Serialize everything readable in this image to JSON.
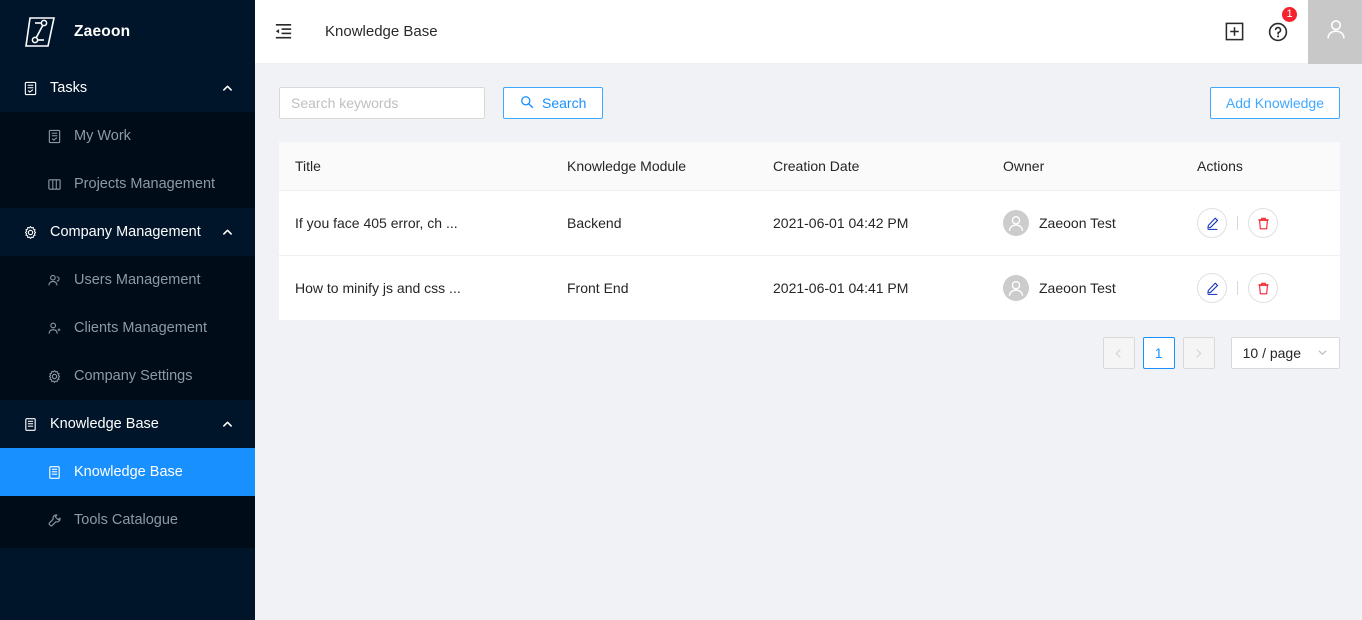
{
  "brand": {
    "name": "Zaeoon",
    "logo_icon": "zaeoon-z-logo",
    "accent": "#1890ff",
    "sidebar_bg": "#001529"
  },
  "sidebar": {
    "groups": [
      {
        "label": "Tasks",
        "icon": "tasks-book-icon",
        "expanded": true,
        "items": [
          {
            "label": "My Work",
            "icon": "book-icon",
            "active": false
          },
          {
            "label": "Projects Management",
            "icon": "project-board-icon",
            "active": false
          }
        ]
      },
      {
        "label": "Company Management",
        "icon": "gear-icon",
        "expanded": true,
        "items": [
          {
            "label": "Users Management",
            "icon": "team-icon",
            "active": false
          },
          {
            "label": "Clients Management",
            "icon": "user-add-icon",
            "active": false
          },
          {
            "label": "Company Settings",
            "icon": "gear-icon",
            "active": false
          }
        ]
      },
      {
        "label": "Knowledge Base",
        "icon": "book-icon",
        "expanded": true,
        "items": [
          {
            "label": "Knowledge Base",
            "icon": "book-icon",
            "active": true
          },
          {
            "label": "Tools Catalogue",
            "icon": "wrench-icon",
            "active": false
          }
        ]
      }
    ],
    "collapse_chevron_icon": "chevron-up-icon"
  },
  "topbar": {
    "fold_icon": "menu-fold-icon",
    "title": "Knowledge Base",
    "add_icon": "plus-square-icon",
    "help_icon": "question-circle-icon",
    "help_badge": "1",
    "badge_color": "#f5222d",
    "avatar_icon": "user-avatar-icon"
  },
  "toolbar": {
    "search_placeholder": "Search keywords",
    "search_value": "",
    "search_icon": "search-icon",
    "search_button": "Search",
    "add_button": "Add Knowledge"
  },
  "table": {
    "columns": [
      "Title",
      "Knowledge Module",
      "Creation Date",
      "Owner",
      "Actions"
    ],
    "rows": [
      {
        "title": "If you face 405 error, ch ...",
        "module": "Backend",
        "created": "2021-06-01 04:42 PM",
        "owner": "Zaeoon Test",
        "owner_avatar_icon": "user-avatar-icon",
        "edit_icon": "edit-pen-icon",
        "delete_icon": "trash-icon"
      },
      {
        "title": "How to minify js and css ...",
        "module": "Front End",
        "created": "2021-06-01 04:41 PM",
        "owner": "Zaeoon Test",
        "owner_avatar_icon": "user-avatar-icon",
        "edit_icon": "edit-pen-icon",
        "delete_icon": "trash-icon"
      }
    ]
  },
  "pagination": {
    "prev_icon": "chevron-left-icon",
    "next_icon": "chevron-right-icon",
    "current_page": "1",
    "page_size": "10 / page",
    "dropdown_icon": "chevron-down-icon"
  }
}
